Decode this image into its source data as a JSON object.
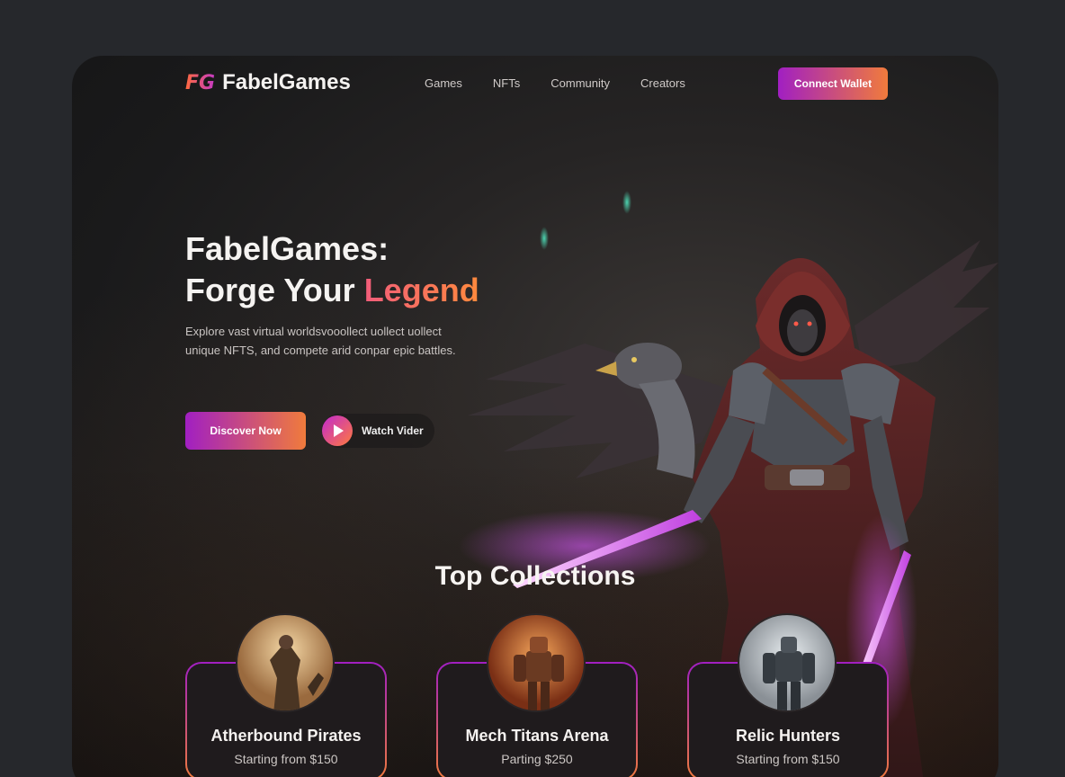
{
  "brand": {
    "mark": "FG",
    "name": "FabelGames"
  },
  "nav": {
    "items": [
      "Games",
      "NFTs",
      "Community",
      "Creators"
    ],
    "cta": "Connect Wallet"
  },
  "hero": {
    "title_line1": "FabelGames:",
    "title_line2_plain": "Forge Your ",
    "title_line2_accent": "Legend",
    "description": "Explore vast virtual worldsvooollect uollect uollect unique NFTS, and compete arid conpar epic battles.",
    "primary_cta": "Discover Now",
    "secondary_cta": "Watch Vider"
  },
  "collections": {
    "title": "Top Collections",
    "items": [
      {
        "name": "Atherbound Pirates",
        "price": "Starting from $150"
      },
      {
        "name": "Mech Titans Arena",
        "price": "Parting $250"
      },
      {
        "name": "Relic Hunters",
        "price": "Starting from $150"
      }
    ]
  },
  "colors": {
    "accent_start": "#a11fc2",
    "accent_end": "#f07b3c",
    "page_bg": "#26282c"
  },
  "icons": {
    "play": "play-icon"
  }
}
